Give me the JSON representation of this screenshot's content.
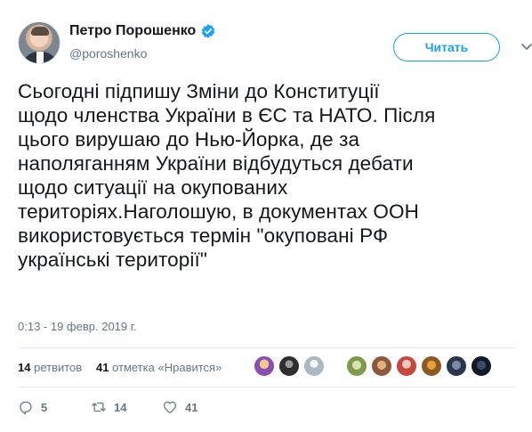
{
  "author": {
    "display_name": "Петро Порошенко",
    "username": "@poroshenko",
    "verified": true,
    "avatar_icon": "user-avatar"
  },
  "follow_button": {
    "label": "Читать"
  },
  "menu_icon": "chevron-down-icon",
  "tweet": {
    "text": "Сьогодні підпишу Зміни до Конституції\nщодо членства України в ЄС та НАТО. Після\nцього вирушаю до Нью-Йорка, де за\nнаполяганням України відбудуться дебати\nщодо ситуації на окупованих\nтериторіях.Наголошую, в документах ООН\nвикористовується термін \"окуповані РФ\nукраїнські території\"",
    "timestamp": "0:13 - 19 февр. 2019 г."
  },
  "stats": {
    "retweets_count": "14",
    "retweets_label": "ретвитов",
    "likes_count": "41",
    "likes_label": "отметка «Нравится»"
  },
  "actions": {
    "reply_count": "5",
    "retweet_count": "14",
    "like_count": "41"
  },
  "colors": {
    "accent": "#1da1f2",
    "text_primary": "#14171a",
    "text_secondary": "#657786",
    "divider": "#e6ecf0"
  }
}
